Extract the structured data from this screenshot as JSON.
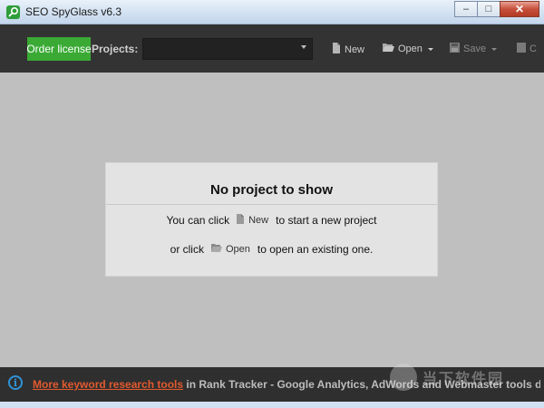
{
  "window": {
    "title": "SEO SpyGlass v6.3",
    "controls": {
      "minimize": "–",
      "maximize": "□",
      "close": "✕"
    }
  },
  "toolbar": {
    "order_license": "Order license",
    "projects_label": "Projects:",
    "projects_value": "",
    "new_label": "New",
    "open_label": "Open",
    "save_label": "Save",
    "close_label": "C"
  },
  "empty_state": {
    "title": "No project to show",
    "line1_prefix": "You can click",
    "line1_button": "New",
    "line1_suffix": "to start a new project",
    "line2_prefix": "or click",
    "line2_button": "Open",
    "line2_suffix": "to open an existing one."
  },
  "infobar": {
    "icon": "i",
    "link_text": "More keyword research tools",
    "rest_text": " in Rank Tracker - Google Analytics, AdWords and Webmaster tools data ad"
  },
  "watermark": {
    "text": "当下软件园"
  },
  "colors": {
    "accent_green": "#3aaa35",
    "link_orange": "#e35a2e",
    "toolbar_bg": "#333333"
  }
}
